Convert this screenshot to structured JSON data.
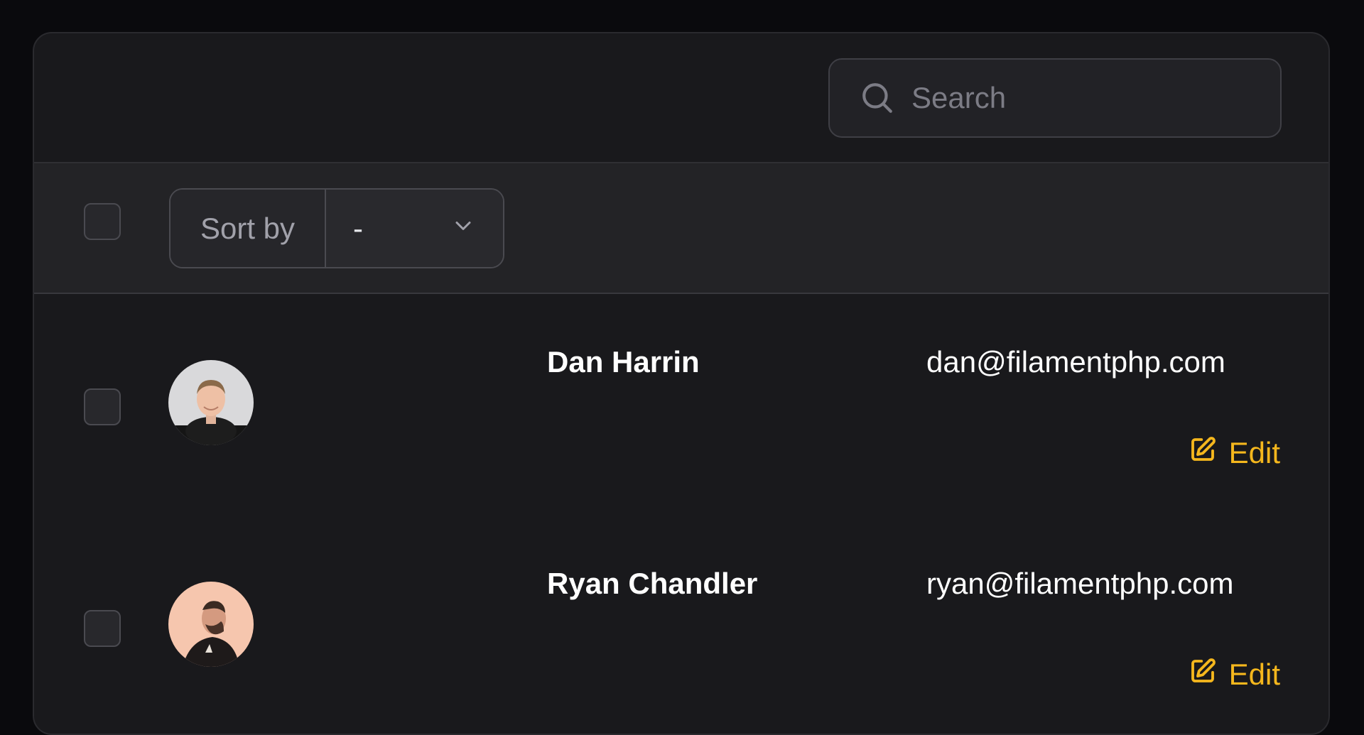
{
  "search": {
    "placeholder": "Search"
  },
  "sort": {
    "label": "Sort by",
    "selected": "-"
  },
  "rows": [
    {
      "name": "Dan Harrin",
      "email": "dan@filamentphp.com",
      "action": "Edit"
    },
    {
      "name": "Ryan Chandler",
      "email": "ryan@filamentphp.com",
      "action": "Edit"
    }
  ],
  "colors": {
    "accent": "#f5b71d",
    "background": "#19191c"
  }
}
